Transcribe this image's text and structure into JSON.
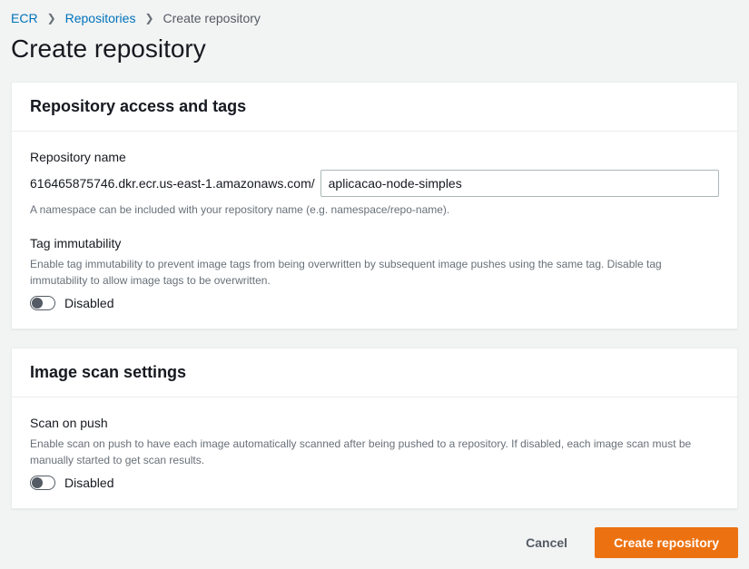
{
  "breadcrumb": {
    "root": "ECR",
    "mid": "Repositories",
    "current": "Create repository"
  },
  "page_title": "Create repository",
  "panel1": {
    "title": "Repository access and tags",
    "repo_name_label": "Repository name",
    "repo_prefix": "616465875746.dkr.ecr.us-east-1.amazonaws.com/",
    "repo_value": "aplicacao-node-simples",
    "repo_hint": "A namespace can be included with your repository name (e.g. namespace/repo-name).",
    "tag_label": "Tag immutability",
    "tag_desc": "Enable tag immutability to prevent image tags from being overwritten by subsequent image pushes using the same tag. Disable tag immutability to allow image tags to be overwritten.",
    "tag_state": "Disabled"
  },
  "panel2": {
    "title": "Image scan settings",
    "scan_label": "Scan on push",
    "scan_desc": "Enable scan on push to have each image automatically scanned after being pushed to a repository. If disabled, each image scan must be manually started to get scan results.",
    "scan_state": "Disabled"
  },
  "actions": {
    "cancel": "Cancel",
    "submit": "Create repository"
  }
}
